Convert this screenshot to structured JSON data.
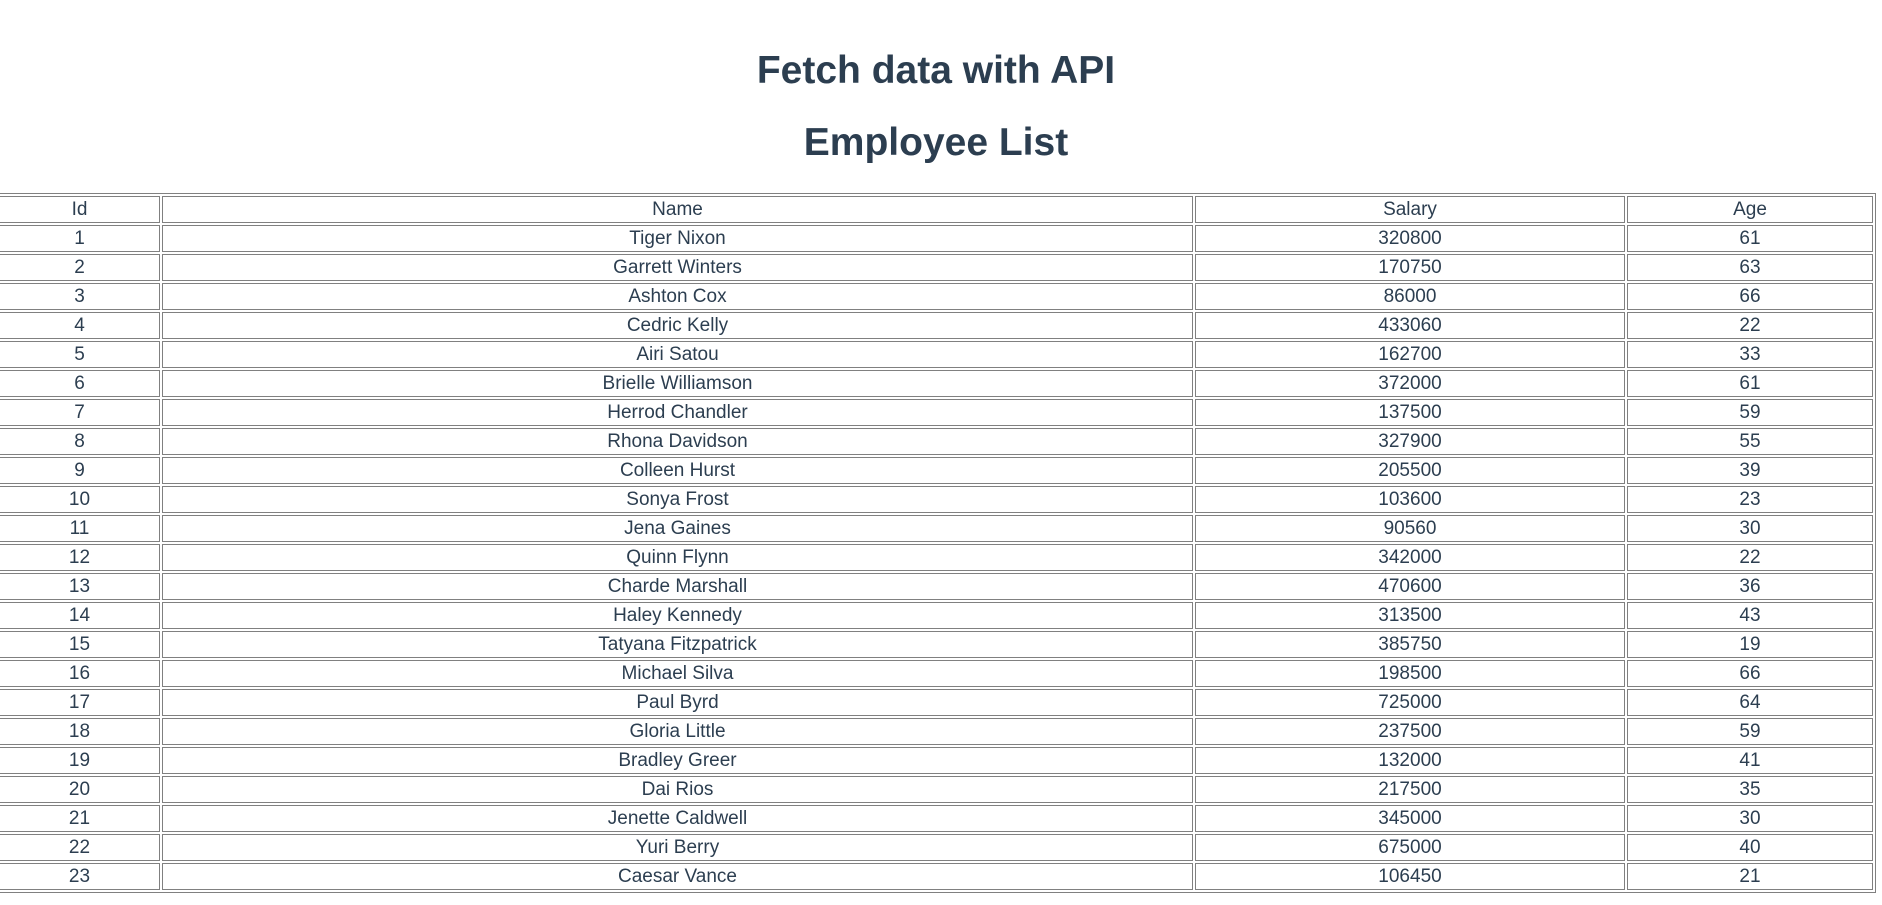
{
  "headings": {
    "title": "Fetch data with API",
    "subtitle": "Employee List"
  },
  "table": {
    "columns": [
      "Id",
      "Name",
      "Salary",
      "Age"
    ],
    "rows": [
      [
        "1",
        "Tiger Nixon",
        "320800",
        "61"
      ],
      [
        "2",
        "Garrett Winters",
        "170750",
        "63"
      ],
      [
        "3",
        "Ashton Cox",
        "86000",
        "66"
      ],
      [
        "4",
        "Cedric Kelly",
        "433060",
        "22"
      ],
      [
        "5",
        "Airi Satou",
        "162700",
        "33"
      ],
      [
        "6",
        "Brielle Williamson",
        "372000",
        "61"
      ],
      [
        "7",
        "Herrod Chandler",
        "137500",
        "59"
      ],
      [
        "8",
        "Rhona Davidson",
        "327900",
        "55"
      ],
      [
        "9",
        "Colleen Hurst",
        "205500",
        "39"
      ],
      [
        "10",
        "Sonya Frost",
        "103600",
        "23"
      ],
      [
        "11",
        "Jena Gaines",
        "90560",
        "30"
      ],
      [
        "12",
        "Quinn Flynn",
        "342000",
        "22"
      ],
      [
        "13",
        "Charde Marshall",
        "470600",
        "36"
      ],
      [
        "14",
        "Haley Kennedy",
        "313500",
        "43"
      ],
      [
        "15",
        "Tatyana Fitzpatrick",
        "385750",
        "19"
      ],
      [
        "16",
        "Michael Silva",
        "198500",
        "66"
      ],
      [
        "17",
        "Paul Byrd",
        "725000",
        "64"
      ],
      [
        "18",
        "Gloria Little",
        "237500",
        "59"
      ],
      [
        "19",
        "Bradley Greer",
        "132000",
        "41"
      ],
      [
        "20",
        "Dai Rios",
        "217500",
        "35"
      ],
      [
        "21",
        "Jenette Caldwell",
        "345000",
        "30"
      ],
      [
        "22",
        "Yuri Berry",
        "675000",
        "40"
      ],
      [
        "23",
        "Caesar Vance",
        "106450",
        "21"
      ]
    ]
  }
}
